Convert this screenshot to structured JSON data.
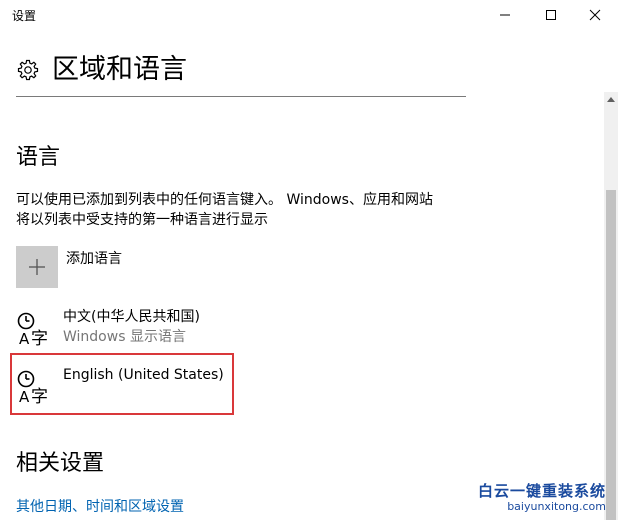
{
  "window": {
    "title": "设置",
    "controls": {
      "minimize": "minimize-icon",
      "maximize": "maximize-icon",
      "close": "close-icon"
    }
  },
  "header": {
    "icon": "gear-icon",
    "title": "区域和语言"
  },
  "language_section": {
    "title": "语言",
    "description_line1": "可以使用已添加到列表中的任何语言键入。 Windows、应用和网站",
    "description_line2": "将以列表中受支持的第一种语言进行显示",
    "add_language_label": "添加语言",
    "items": [
      {
        "name": "中文(中华人民共和国)",
        "subtitle": "Windows 显示语言",
        "icon": "language-icon"
      },
      {
        "name": "English (United States)",
        "subtitle": "",
        "icon": "language-icon"
      }
    ]
  },
  "related_section": {
    "title": "相关设置",
    "link": "其他日期、时间和区域设置"
  },
  "watermark": {
    "main": "白云一键重装系统",
    "sub": "baiyunxitong.com"
  },
  "colors": {
    "link": "#0063b1",
    "highlight": "#d9383a",
    "plus_bg": "#cccccc",
    "secondary_text": "#767676"
  }
}
